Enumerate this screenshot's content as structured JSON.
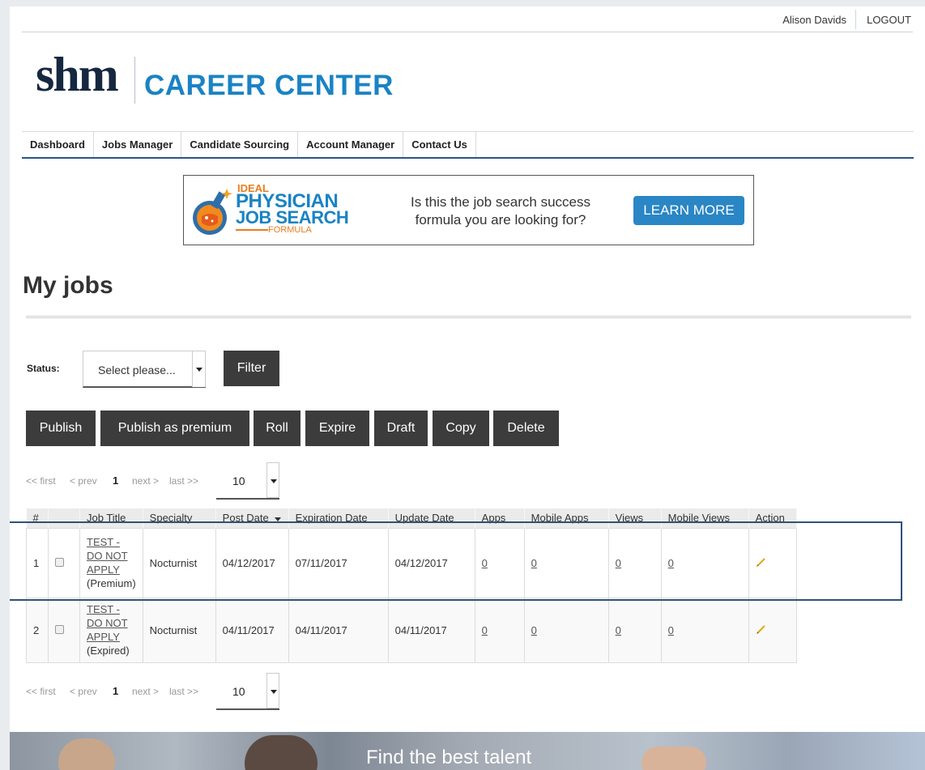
{
  "topbar": {
    "user_name": "Alison Davids",
    "logout": "LOGOUT"
  },
  "logo": {
    "shm": "shm",
    "career": "CAREER CENTER"
  },
  "nav": [
    "Dashboard",
    "Jobs Manager",
    "Candidate Sourcing",
    "Account Manager",
    "Contact Us"
  ],
  "banner": {
    "ideal": "IDEAL",
    "physician": "PHYSICIAN",
    "job_search": "JOB SEARCH",
    "formula": "FORMULA",
    "text_line1": "Is this the job search success",
    "text_line2": "formula you are looking for?",
    "button": "LEARN MORE"
  },
  "page_title": "My jobs",
  "status": {
    "label": "Status:",
    "select_value": "Select please...",
    "filter_button": "Filter"
  },
  "actions": [
    "Publish",
    "Publish as premium",
    "Roll",
    "Expire",
    "Draft",
    "Copy",
    "Delete"
  ],
  "pager": {
    "first": "<< first",
    "prev": "< prev",
    "current": "1",
    "next": "next >",
    "last": "last >>",
    "per_page": "10"
  },
  "table": {
    "headers": [
      "#",
      "",
      "Job Title",
      "Specialty",
      "Post Date",
      "Expiration Date",
      "Update Date",
      "Apps",
      "Mobile Apps",
      "Views",
      "Mobile Views",
      "Action"
    ],
    "rows": [
      {
        "num": "1",
        "title_l1": "TEST -",
        "title_l2": "DO NOT",
        "title_l3": "APPLY",
        "status": "(Premium)",
        "specialty": "Nocturnist",
        "post_date": "04/12/2017",
        "expiration_date": "07/11/2017",
        "update_date": "04/12/2017",
        "apps": "0",
        "mobile_apps": "0",
        "views": "0",
        "mobile_views": "0"
      },
      {
        "num": "2",
        "title_l1": "TEST -",
        "title_l2": "DO NOT",
        "title_l3": "APPLY",
        "status": "(Expired)",
        "specialty": "Nocturnist",
        "post_date": "04/11/2017",
        "expiration_date": "04/11/2017",
        "update_date": "04/11/2017",
        "apps": "0",
        "mobile_apps": "0",
        "views": "0",
        "mobile_views": "0"
      }
    ]
  },
  "hero_text": "Find the best talent",
  "icons": {
    "sort": "sort-caret-down-icon",
    "edit": "pencil-icon",
    "dropdown": "caret-down-icon"
  },
  "colors": {
    "accent": "#1a83c4",
    "nav_rule": "#2a5585",
    "button_dark": "#3c3c3c"
  }
}
